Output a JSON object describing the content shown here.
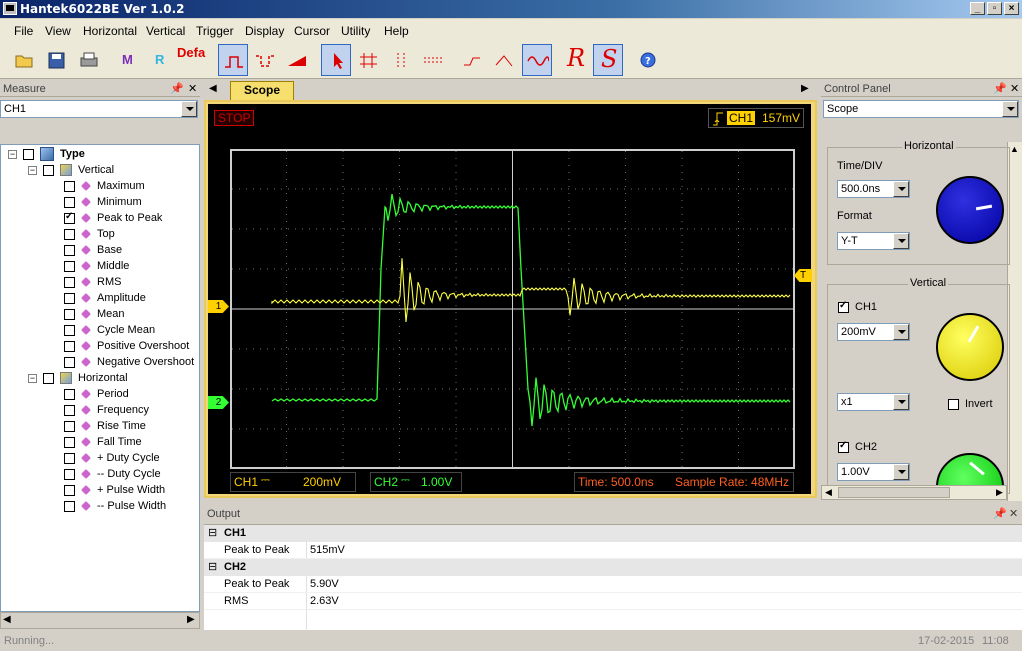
{
  "window": {
    "title": "Hantek6022BE Ver 1.0.2"
  },
  "menu": [
    "File",
    "View",
    "Horizontal",
    "Vertical",
    "Trigger",
    "Display",
    "Cursor",
    "Utility",
    "Help"
  ],
  "toolbar": {
    "m_label": "M",
    "r_label": "R",
    "default_label": "Defa"
  },
  "measure_panel": {
    "title": "Measure",
    "channel_select": "CH1",
    "tree": {
      "root": "Type",
      "vertical_label": "Vertical",
      "vertical_items": [
        {
          "label": "Maximum",
          "checked": false
        },
        {
          "label": "Minimum",
          "checked": false
        },
        {
          "label": "Peak to Peak",
          "checked": true
        },
        {
          "label": "Top",
          "checked": false
        },
        {
          "label": "Base",
          "checked": false
        },
        {
          "label": "Middle",
          "checked": false
        },
        {
          "label": "RMS",
          "checked": false
        },
        {
          "label": "Amplitude",
          "checked": false
        },
        {
          "label": "Mean",
          "checked": false
        },
        {
          "label": "Cycle Mean",
          "checked": false
        },
        {
          "label": "Positive Overshoot",
          "checked": false
        },
        {
          "label": "Negative Overshoot",
          "checked": false
        }
      ],
      "horizontal_label": "Horizontal",
      "horizontal_items": [
        {
          "label": "Period",
          "checked": false
        },
        {
          "label": "Frequency",
          "checked": false
        },
        {
          "label": "Rise Time",
          "checked": false
        },
        {
          "label": "Fall Time",
          "checked": false
        },
        {
          "label": "+ Duty Cycle",
          "checked": false
        },
        {
          "label": "-- Duty Cycle",
          "checked": false
        },
        {
          "label": "+ Pulse Width",
          "checked": false
        },
        {
          "label": "-- Pulse Width",
          "checked": false
        }
      ]
    }
  },
  "scope": {
    "tab": "Scope",
    "state": "STOP",
    "trigger_channel": "CH1",
    "trigger_level": "157mV",
    "ch1_label": "CH1",
    "ch1_scale": "200mV",
    "ch2_label": "CH2",
    "ch2_scale": "1.00V",
    "time": "Time: 500.0ns",
    "sample_rate": "Sample Rate: 48MHz",
    "marker_ch1": "1",
    "marker_ch2": "2",
    "marker_trig": "T",
    "colors": {
      "ch1": "#ffff40",
      "ch2": "#33ff33",
      "text": "#cc0000"
    }
  },
  "control_panel": {
    "title": "Control Panel",
    "mode_select": "Scope",
    "horizontal": {
      "title": "Horizontal",
      "time_div_label": "Time/DIV",
      "time_div": "500.0ns",
      "format_label": "Format",
      "format": "Y-T"
    },
    "vertical": {
      "title": "Vertical",
      "ch1_label": "CH1",
      "ch1_checked": true,
      "ch1_volts": "200mV",
      "ch1_probe": "x1",
      "invert_label": "Invert",
      "invert_checked": false,
      "ch2_label": "CH2",
      "ch2_checked": true,
      "ch2_volts": "1.00V"
    }
  },
  "output": {
    "title": "Output",
    "groups": [
      {
        "channel": "CH1",
        "rows": [
          {
            "name": "Peak to Peak",
            "value": "515mV"
          }
        ]
      },
      {
        "channel": "CH2",
        "rows": [
          {
            "name": "Peak to Peak",
            "value": "5.90V"
          },
          {
            "name": "RMS",
            "value": "2.63V"
          }
        ]
      }
    ]
  },
  "status": {
    "left": "Running...",
    "date": "17-02-2015",
    "time": "11:08"
  }
}
